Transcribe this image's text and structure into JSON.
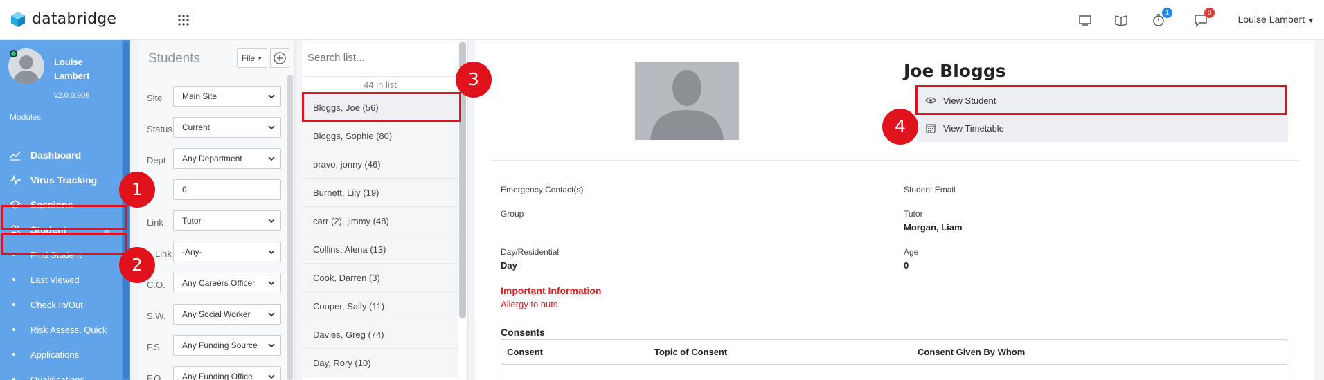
{
  "app": {
    "name": "databridge"
  },
  "topbar": {
    "icons": [
      "monitor-icon",
      "book-icon",
      "timer-icon",
      "chat-icon"
    ],
    "timer_badge": "1",
    "chat_badge": "8",
    "user_name": "Louise Lambert"
  },
  "sidebar": {
    "user_name": "Louise Lambert",
    "version": "v2.0.0.906",
    "modules_label": "Modules",
    "items": [
      {
        "label": "Dashboard",
        "icon": "chart-line-icon"
      },
      {
        "label": "Virus Tracking",
        "icon": "pulse-icon"
      },
      {
        "label": "Sessions",
        "icon": "layers-icon"
      },
      {
        "label": "Student",
        "icon": "users-icon"
      }
    ],
    "sub_items": [
      {
        "label": "Find Student"
      },
      {
        "label": "Last Viewed"
      },
      {
        "label": "Check In/Out"
      },
      {
        "label": "Risk Assess. Quick"
      },
      {
        "label": "Applications"
      },
      {
        "label": "Qualifications"
      }
    ]
  },
  "filters": {
    "title": "Students",
    "file_label": "File",
    "fields": [
      {
        "label": "Site",
        "value": "Main Site"
      },
      {
        "label": "Status",
        "value": "Current"
      },
      {
        "label": "Dept",
        "value": "Any Department"
      },
      {
        "label": "",
        "value": "0"
      },
      {
        "label": "Link",
        "value": "Tutor"
      },
      {
        "label": "Link",
        "value": "-Any-"
      },
      {
        "label": "C.O.",
        "value": "Any Careers Officer"
      },
      {
        "label": "S.W.",
        "value": "Any Social Worker"
      },
      {
        "label": "F.S.",
        "value": "Any Funding Source"
      },
      {
        "label": "F.O.",
        "value": "Any Funding Office"
      }
    ]
  },
  "list": {
    "search_placeholder": "Search list...",
    "count": "44 in list",
    "items": [
      "Bloggs, Joe (56)",
      "Bloggs, Sophie (80)",
      "bravo, jonny (46)",
      "Burnett, Lily (19)",
      "carr (2), jimmy (48)",
      "Collins, Alena (13)",
      "Cook, Darren (3)",
      "Cooper, Sally (11)",
      "Davies, Greg (74)",
      "Day, Rory (10)"
    ]
  },
  "student": {
    "name": "Joe Bloggs",
    "view_student": "View Student",
    "view_timetable": "View Timetable",
    "emergency_label": "Emergency Contact(s)",
    "email_label": "Student Email",
    "group_label": "Group",
    "tutor_label": "Tutor",
    "tutor_value": "Morgan, Liam",
    "day_label": "Day/Residential",
    "day_value": "Day",
    "age_label": "Age",
    "age_value": "0",
    "important_title": "Important Information",
    "important_value": "Allergy to nuts",
    "consents_title": "Consents",
    "consent_headers": [
      "Consent",
      "Topic of Consent",
      "Consent Given By Whom"
    ]
  },
  "annotations": [
    "1",
    "2",
    "3",
    "4"
  ],
  "colors": {
    "sidebar": "#62a4ea",
    "highlight": "#e0121b",
    "important": "#e02020"
  }
}
